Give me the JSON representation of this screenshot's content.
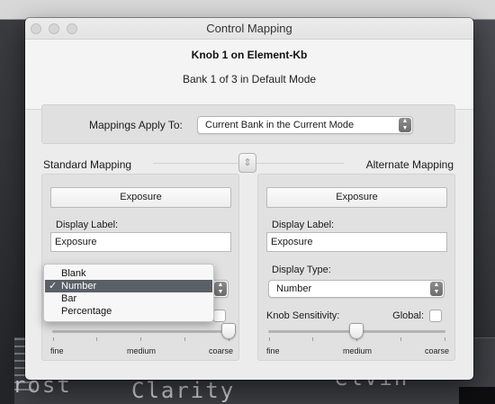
{
  "window": {
    "title": "Control Mapping"
  },
  "header": {
    "title": "Knob 1 on Element-Kb",
    "subtitle": "Bank 1 of 3 in Default Mode"
  },
  "apply": {
    "label": "Mappings Apply To:",
    "value": "Current Bank in the Current Mode"
  },
  "sections": {
    "standard": "Standard Mapping",
    "alternate": "Alternate Mapping"
  },
  "standard": {
    "function_button": "Exposure",
    "display_label_label": "Display Label:",
    "display_label_value": "Exposure",
    "display_type_menu": {
      "options": [
        "Blank",
        "Number",
        "Bar",
        "Percentage"
      ],
      "selected": "Number"
    },
    "scale": {
      "fine": "fine",
      "medium": "medium",
      "coarse": "coarse"
    },
    "sensitivity": "coarse"
  },
  "alternate": {
    "function_button": "Exposure",
    "display_label_label": "Display Label:",
    "display_label_value": "Exposure",
    "display_type_label": "Display Type:",
    "display_type_value": "Number",
    "knob_sensitivity_label": "Knob Sensitivity:",
    "global_label": "Global:",
    "scale": {
      "fine": "fine",
      "medium": "medium",
      "coarse": "coarse"
    },
    "sensitivity": "medium"
  },
  "background": {
    "text_left": "rost",
    "text_mid": "Clarity",
    "text_right": "elvin"
  },
  "icons": {
    "toggle": "swap-toggle-icon",
    "check": "checkmark-icon",
    "stepper": "up-down-chevron-icon"
  }
}
